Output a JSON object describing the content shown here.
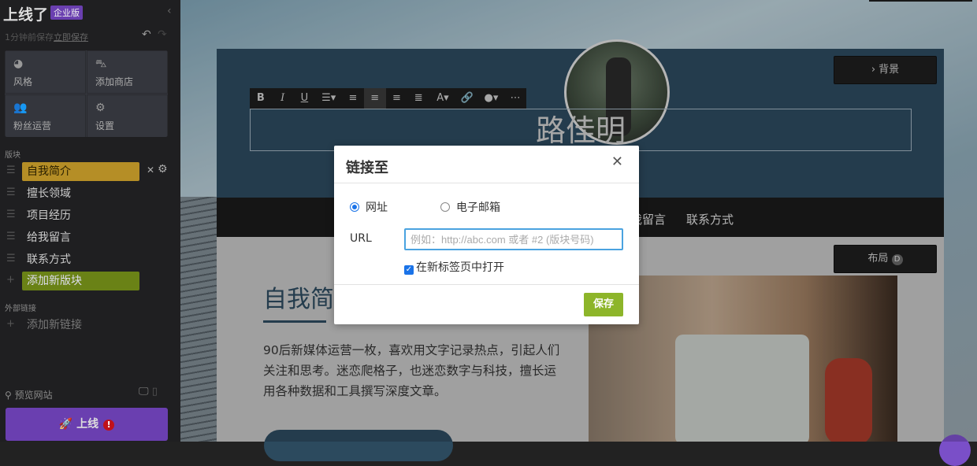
{
  "sidebar": {
    "logo": "上线了",
    "edition": "企业版",
    "save_status": "1分钟前保存",
    "save_now": "立即保存",
    "tiles": [
      {
        "label": "风格",
        "icon": "palette-icon"
      },
      {
        "label": "添加商店",
        "icon": "shop-bag-icon"
      },
      {
        "label": "粉丝运营",
        "icon": "users-icon"
      },
      {
        "label": "设置",
        "icon": "gear-icon"
      }
    ],
    "blocks_title": "版块",
    "blocks": [
      "自我简介",
      "擅长领域",
      "项目经历",
      "给我留言",
      "联系方式"
    ],
    "add_block": "添加新版块",
    "links_title": "外部链接",
    "add_link": "添加新链接",
    "preview": "预览网站",
    "go_live": "上线"
  },
  "page": {
    "bg_button": "› 背景",
    "name": "路佳明",
    "nav": [
      "给我留言",
      "联系方式"
    ],
    "layout_button": "布局",
    "layout_key": "D",
    "heading": "自我简介",
    "paragraph": "90后新媒体运营一枚，喜欢用文字记录热点，引起人们关注和思考。迷恋爬格子，也迷恋数字与科技，擅长运用各种数据和工具撰写深度文章。"
  },
  "toolbar": {
    "buttons": [
      "B",
      "I",
      "U",
      "☰▾",
      "≡",
      "≡",
      "≡",
      "≣",
      "A▾",
      "🔗",
      "●▾",
      "⋯"
    ]
  },
  "modal": {
    "title": "链接至",
    "option_url": "网址",
    "option_email": "电子邮箱",
    "url_label": "URL",
    "url_placeholder": "例如：http://abc.com 或者 #2 (版块号码)",
    "url_value": "",
    "new_tab": "在新标签页中打开",
    "save": "保存"
  },
  "colors": {
    "accent": "#6a3fb0",
    "active_block": "#b58e26",
    "add_block": "#6a8216",
    "save": "#8db52a",
    "header": "#2c4a5e"
  }
}
